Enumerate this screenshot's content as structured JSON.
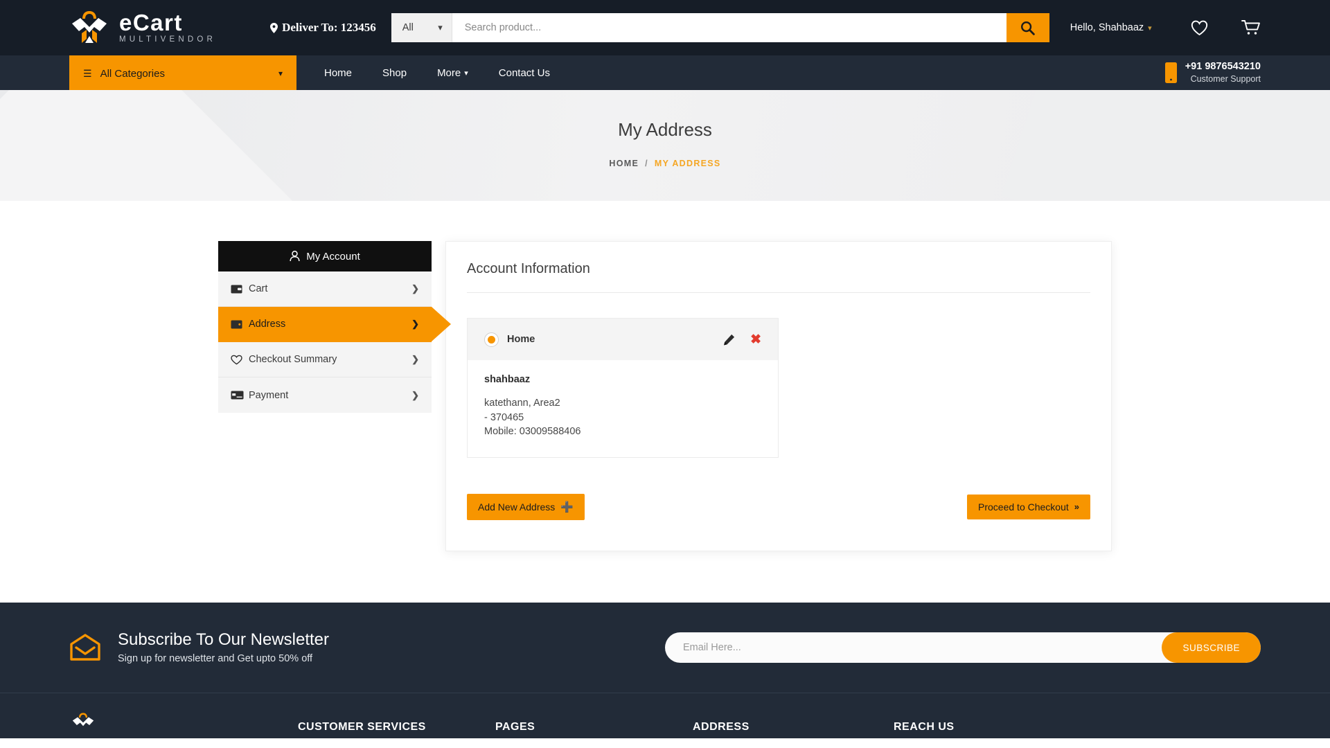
{
  "header": {
    "logo": {
      "title": "eCart",
      "subtitle": "MULTIVENDOR",
      "icon": "bag-logo-icon"
    },
    "deliver_to": "Deliver To: 123456",
    "search": {
      "category_selected": "All",
      "placeholder": "Search product...",
      "value": "",
      "button_icon": "search-icon"
    },
    "account_greeting": "Hello, Shahbaaz",
    "wishlist_icon": "heart-icon",
    "cart_icon": "cart-icon"
  },
  "nav": {
    "all_categories": "All Categories",
    "links": [
      {
        "label": "Home",
        "caret": false
      },
      {
        "label": "Shop",
        "caret": false
      },
      {
        "label": "More",
        "caret": true
      },
      {
        "label": "Contact Us",
        "caret": false
      }
    ],
    "support": {
      "number": "+91 9876543210",
      "label": "Customer Support",
      "icon": "mobile-phone-icon"
    }
  },
  "banner": {
    "title": "My Address",
    "breadcrumb": {
      "home": "HOME",
      "separator": "/",
      "current": "MY ADDRESS"
    }
  },
  "sidebar": {
    "heading": "My Account",
    "heading_icon": "user-icon",
    "items": [
      {
        "label": "Cart",
        "icon": "wallet-icon",
        "active": false
      },
      {
        "label": "Address",
        "icon": "wallet-card-icon",
        "active": true
      },
      {
        "label": "Checkout Summary",
        "icon": "heart-icon",
        "active": false
      },
      {
        "label": "Payment",
        "icon": "credit-card-icon",
        "active": false
      }
    ]
  },
  "panel": {
    "title": "Account Information",
    "address": {
      "type": "Home",
      "selected": true,
      "edit_icon": "pencil-icon",
      "delete_icon": "close-x-icon",
      "name": "shahbaaz",
      "line1": "katethann, Area2",
      "line2": "- 370465",
      "line3": "Mobile: 03009588406"
    },
    "add_button": "Add New Address",
    "add_button_icon": "plus-icon",
    "checkout_button": "Proceed to Checkout",
    "checkout_button_icon": "double-chevron-right-icon"
  },
  "newsletter": {
    "icon": "envelope-open-icon",
    "title": "Subscribe To Our Newsletter",
    "subtitle": "Sign up for newsletter and Get upto 50% off",
    "placeholder": "Email Here...",
    "value": "",
    "button": "SUBSCRIBE"
  },
  "footer": {
    "columns": [
      {
        "heading": "CUSTOMER SERVICES"
      },
      {
        "heading": "PAGES"
      },
      {
        "heading": "ADDRESS"
      },
      {
        "heading": "REACH US"
      }
    ]
  },
  "colors": {
    "accent": "#f79500",
    "dark_header": "#161d27",
    "dark_nav": "#222b38",
    "danger": "#e23b2e",
    "sidebar_head": "#101010"
  }
}
